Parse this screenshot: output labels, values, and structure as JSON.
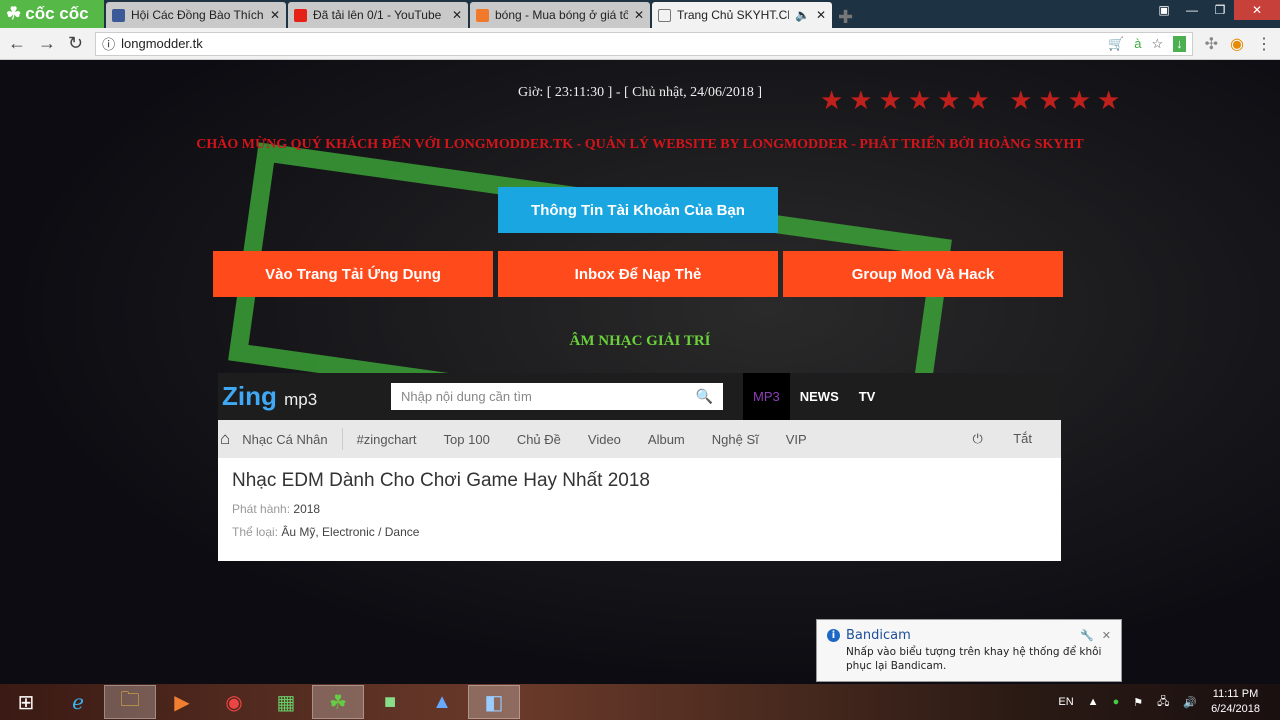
{
  "browser": {
    "brand": "cốc cốc",
    "tabs": [
      {
        "title": "Hội Các Đồng Bào Thích M",
        "icon": "facebook-icon",
        "color": "#3b5998"
      },
      {
        "title": "Đã tải lên 0/1 - YouTube",
        "icon": "youtube-icon",
        "color": "#e62117"
      },
      {
        "title": "bóng - Mua bóng ở giá tố",
        "icon": "shop-icon",
        "color": "#f07a2a"
      },
      {
        "title": "Trang Chủ SKYHT.CF",
        "icon": "page-icon",
        "color": "#ffffff",
        "active": true,
        "audio": "🔈"
      }
    ],
    "url": "longmodder.tk"
  },
  "page": {
    "clock": "Giờ: [ 23:11:30 ] - [ Chủ nhật, 24/06/2018 ]",
    "welcome": "CHÀO MỪNG QUÝ KHÁCH ĐẾN VỚI LONGMODDER.TK - QUẢN LÝ WEBSITE BY LONGMODDER - PHÁT TRIỂN BỞI HOÀNG SKYHT",
    "account_button": "Thông Tin Tài Khoản Của Bạn",
    "buttons": [
      "Vào Trang Tải Ứng Dụng",
      "Inbox Để Nạp Thẻ",
      "Group Mod Và Hack"
    ],
    "music_heading": "ÂM NHẠC GIẢI TRÍ",
    "colors": {
      "account": "#1aa6e0",
      "action": "#ff4a1c"
    }
  },
  "zing": {
    "logo": "Zing",
    "logo_suffix": "mp3",
    "search_placeholder": "Nhập nội dung cần tìm",
    "tabs": [
      "MP3",
      "NEWS",
      "TV"
    ],
    "menu": [
      "Nhạc Cá Nhân",
      "#zingchart",
      "Top 100",
      "Chủ Đề",
      "Video",
      "Album",
      "Nghệ Sĩ",
      "VIP"
    ],
    "power": "Tắt",
    "title": "Nhạc EDM Dành Cho Chơi Game Hay Nhất 2018",
    "release_label": "Phát hành:",
    "release": "2018",
    "genre_label": "Thể loại:",
    "genre": "Âu Mỹ, Electronic / Dance"
  },
  "notification": {
    "title": "Bandicam",
    "message": "Nhấp vào biểu tượng trên khay hệ thống để khôi phục lại Bandicam."
  },
  "taskbar": {
    "lang": "EN",
    "time": "11:11 PM",
    "date": "6/24/2018"
  }
}
